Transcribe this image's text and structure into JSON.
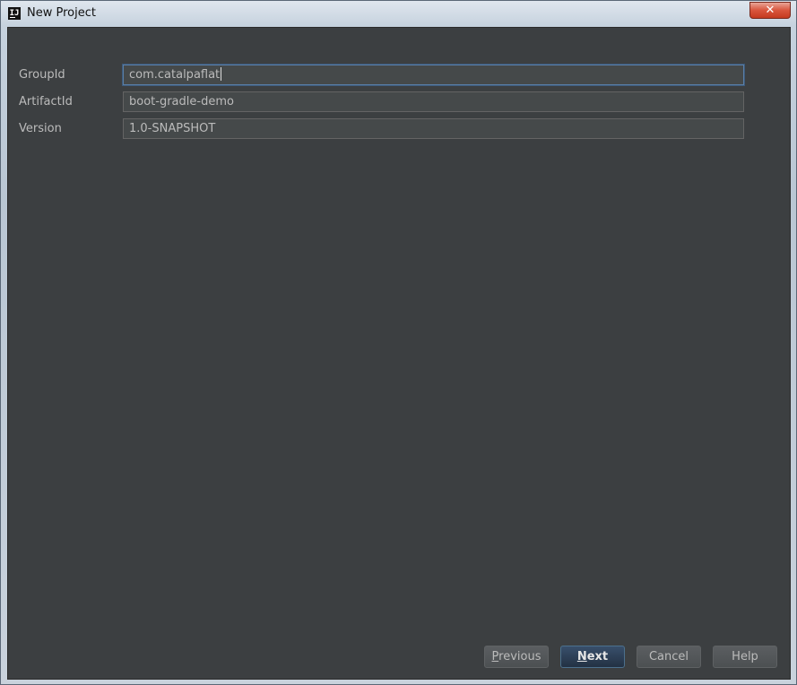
{
  "window": {
    "title": "New Project",
    "close_glyph": "✕",
    "icon": "intellij-idea-icon"
  },
  "form": {
    "fields": [
      {
        "label": "GroupId",
        "value": "com.catalpaflat",
        "focused": true
      },
      {
        "label": "ArtifactId",
        "value": "boot-gradle-demo",
        "focused": false
      },
      {
        "label": "Version",
        "value": "1.0-SNAPSHOT",
        "focused": false
      }
    ]
  },
  "buttons": {
    "previous": {
      "mnemonic": "P",
      "rest": "revious"
    },
    "next": {
      "mnemonic": "N",
      "rest": "ext"
    },
    "cancel": "Cancel",
    "help": "Help"
  },
  "colors": {
    "panel_background": "#3c3f41",
    "field_background": "#45494a",
    "focus_border": "#5a7fa8",
    "default_button": "#2d4158",
    "close_button": "#c43a1f"
  }
}
